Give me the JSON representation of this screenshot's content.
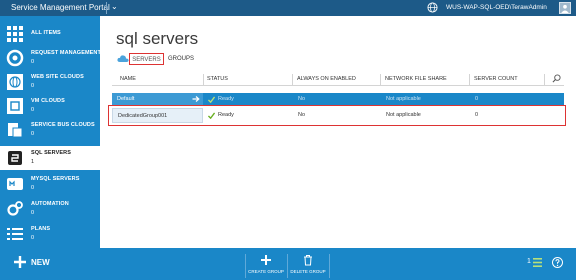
{
  "topbar": {
    "portal_title": "Service Management Portal",
    "user": "WUS-WAP-SQL-OED\\TerawAdmin"
  },
  "sidebar": {
    "items": [
      {
        "label": "ALL ITEMS",
        "count": "",
        "icon": "grid-icon"
      },
      {
        "label": "REQUEST MANAGEMENT",
        "count": "0",
        "icon": "request-icon"
      },
      {
        "label": "WEB SITE CLOUDS",
        "count": "0",
        "icon": "web-icon"
      },
      {
        "label": "VM CLOUDS",
        "count": "0",
        "icon": "vm-icon"
      },
      {
        "label": "SERVICE BUS CLOUDS",
        "count": "0",
        "icon": "service-bus-icon"
      },
      {
        "label": "SQL SERVERS",
        "count": "1",
        "icon": "sql-icon",
        "active": true
      },
      {
        "label": "MYSQL SERVERS",
        "count": "0",
        "icon": "mysql-icon"
      },
      {
        "label": "AUTOMATION",
        "count": "0",
        "icon": "automation-icon"
      },
      {
        "label": "PLANS",
        "count": "0",
        "icon": "plans-icon"
      }
    ]
  },
  "main": {
    "title": "sql servers",
    "subtabs": {
      "servers": "SERVERS",
      "groups": "GROUPS"
    },
    "columns": [
      "NAME",
      "STATUS",
      "ALWAYS ON ENABLED",
      "NETWORK FILE SHARE",
      "SERVER COUNT"
    ],
    "rows": [
      {
        "name": "Default",
        "status": "Ready",
        "always_on": "No",
        "file_share": "Not applicable",
        "server_count": "0"
      },
      {
        "name": "DedicatedGroup001",
        "status": "Ready",
        "always_on": "No",
        "file_share": "Not applicable",
        "server_count": "0"
      }
    ]
  },
  "bottombar": {
    "new_label": "NEW",
    "create_group": "CREATE GROUP",
    "delete_group": "DELETE GROUP",
    "count": "1"
  },
  "colors": {
    "topbar": "#1d5a88",
    "accent": "#1a87c8",
    "highlight": "#dd3333",
    "ready": "#6ab023"
  }
}
